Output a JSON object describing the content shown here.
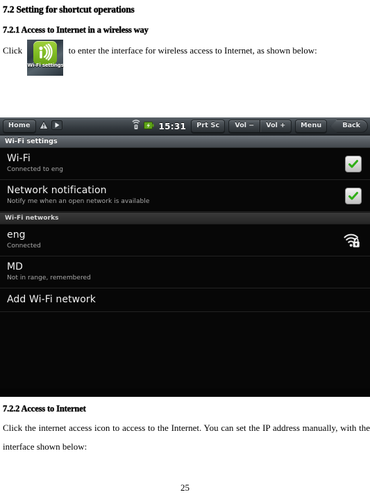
{
  "document": {
    "section_heading": "7.2 Setting for shortcut operations",
    "subsection_heading": "7.2.1 Access to Internet in a wireless way",
    "paragraph_click_prefix": "Click",
    "paragraph_after_icon": "to enter the interface for wireless access to Internet, as shown below:",
    "subsection2_heading": "7.2.2 Access to Internet",
    "paragraph2": "Click the internet access icon to access to the Internet. You can set the IP address manually, with the interface shown below:",
    "page_number": "25",
    "inline_icon_label": "Wi-Fi settings"
  },
  "screenshot": {
    "statusbar": {
      "home_label": "Home",
      "warning_icon": "warning-triangle-icon",
      "play_icon": "play-icon",
      "signal_icon": "signal-icon",
      "battery_icon": "battery-icon",
      "time": "15:31",
      "prtsc_label": "Prt Sc",
      "vol_down_label": "Vol −",
      "vol_up_label": "Vol +",
      "menu_label": "Menu",
      "back_label": "Back"
    },
    "titlebar": {
      "title": "Wi-Fi settings"
    },
    "settings_rows": [
      {
        "title": "Wi-Fi",
        "subtitle": "Connected to eng",
        "checked": true
      },
      {
        "title": "Network notification",
        "subtitle": "Notify me when an open network is available",
        "checked": true
      }
    ],
    "networks_section_header": "Wi-Fi networks",
    "networks": [
      {
        "title": "eng",
        "subtitle": "Connected",
        "icon": "wifi-secure-icon"
      },
      {
        "title": "MD",
        "subtitle": "Not in range, remembered",
        "icon": ""
      }
    ],
    "add_network_label": "Add Wi-Fi network"
  },
  "colors": {
    "accent_green": "#3fae28",
    "panel_black": "#070707",
    "text_primary": "#f2f2f2",
    "text_secondary": "#a9a9a9"
  }
}
